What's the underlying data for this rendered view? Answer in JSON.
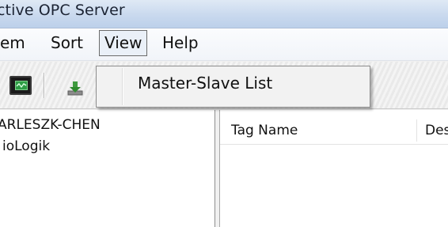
{
  "window": {
    "title": "ctive OPC Server"
  },
  "menubar": {
    "items": [
      {
        "label": "em"
      },
      {
        "label": "Sort"
      },
      {
        "label": "View"
      },
      {
        "label": "Help"
      }
    ]
  },
  "toolbar": {
    "buttons": [
      {
        "icon": "monitor-icon"
      },
      {
        "icon": "import-icon"
      }
    ]
  },
  "view_menu": {
    "items": [
      {
        "label": "Master-Slave List"
      }
    ]
  },
  "tree": {
    "nodes": [
      {
        "label": "ARLESZK-CHEN"
      },
      {
        "label": "ioLogik"
      }
    ]
  },
  "list": {
    "columns": [
      {
        "label": "Tag Name"
      },
      {
        "label": "Des"
      }
    ]
  }
}
